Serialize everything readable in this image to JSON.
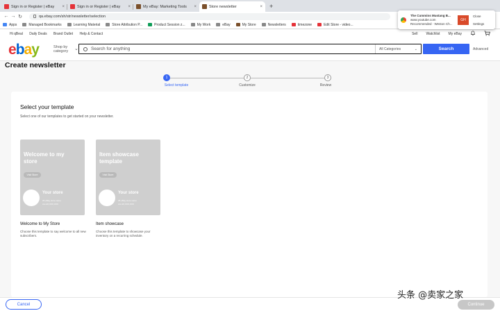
{
  "browser": {
    "tabs": [
      {
        "title": "Sign in or Register | eBay",
        "active": false,
        "favicon_color": "#e53238"
      },
      {
        "title": "Sign in or Register | eBay",
        "active": false,
        "favicon_color": "#e53238"
      },
      {
        "title": "My eBay: Marketing Tools",
        "active": false,
        "favicon_color": "#7a4f2a"
      },
      {
        "title": "Store newsletter",
        "active": true,
        "favicon_color": "#7a4f2a"
      }
    ],
    "new_tab_label": "+",
    "url": "qa.ebay.com/sh/str/newsletter/selection",
    "bookmarks": [
      {
        "label": "Apps",
        "color": "#4285f4"
      },
      {
        "label": "Managed Bookmarks",
        "color": "#888888"
      },
      {
        "label": "Learning Material",
        "color": "#888888"
      },
      {
        "label": "Store Attribution P...",
        "color": "#888888"
      },
      {
        "label": "Product Session z...",
        "color": "#0f9d58"
      },
      {
        "label": "My Work",
        "color": "#888888"
      },
      {
        "label": "eBay",
        "color": "#888888"
      },
      {
        "label": "My Store",
        "color": "#7a4f2a"
      },
      {
        "label": "Newsletters",
        "color": "#888888"
      },
      {
        "label": "timezone",
        "color": "#e53238"
      },
      {
        "label": "Edit Store - video...",
        "color": "#e53238"
      }
    ],
    "notification": {
      "title": "The Cummins Mustang B...",
      "source": "www.youtube.com",
      "detail": "Recommended · Weston Ch...",
      "close_label": "Close",
      "settings_label": "Settings",
      "thumb_text": "GH"
    }
  },
  "ebay_header": {
    "greeting": "Hi qBeal",
    "links_left": [
      "Daily Deals",
      "Brand Outlet",
      "Help & Contact"
    ],
    "links_right": [
      "Sell",
      "Watchlist",
      "My eBay"
    ],
    "shop_by_category": "Shop by category",
    "search_placeholder": "Search for anything",
    "category_select": "All Categories",
    "search_button": "Search",
    "advanced_link": "Advanced"
  },
  "page": {
    "title": "Create newsletter",
    "steps": [
      {
        "number": "1",
        "label": "Select template",
        "active": true
      },
      {
        "number": "2",
        "label": "Customize",
        "active": false
      },
      {
        "number": "3",
        "label": "Review",
        "active": false
      }
    ],
    "card_heading": "Select your template",
    "card_subheading": "Select one of our templates to get started on your newsletter.",
    "templates": [
      {
        "preview_title": "Welcome to my store",
        "preview_button": "Visit Store",
        "preview_store": "Your store",
        "preview_info_1": "25 eBay store name",
        "preview_info_2": "xxx-2X,XXX,XXX",
        "name": "Welcome to My Store",
        "description": "Choose this template to say welcome to all new subscribers."
      },
      {
        "preview_title": "Item showcase template",
        "preview_button": "Visit Store",
        "preview_store": "Your store",
        "preview_info_1": "25 eBay store name",
        "preview_info_2": "xxx-2X,XXX,XXX",
        "name": "Item showcase",
        "description": "Choose this template to showcase your inventory on a recurring schedule."
      }
    ],
    "cancel_button": "Cancel",
    "continue_button": "Continue"
  },
  "watermark": "头条 @卖家之家"
}
